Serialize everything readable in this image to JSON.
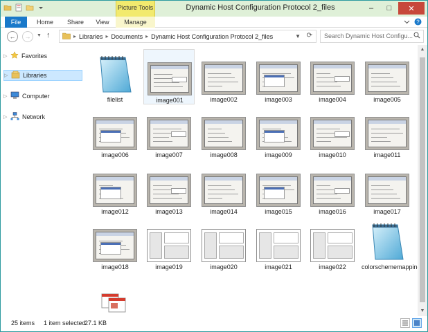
{
  "window": {
    "title": "Dynamic Host Configuration Protocol 2_files",
    "context_tab_group": "Picture Tools",
    "controls": {
      "minimize": "–",
      "maximize": "□",
      "close": "✕"
    }
  },
  "ribbon": {
    "tabs": [
      {
        "label": "File"
      },
      {
        "label": "Home"
      },
      {
        "label": "Share"
      },
      {
        "label": "View"
      },
      {
        "label": "Manage"
      }
    ]
  },
  "navigation": {
    "back": "←",
    "forward": "→",
    "up": "↑",
    "breadcrumb": [
      "Libraries",
      "Documents",
      "Dynamic Host Configuration Protocol 2_files"
    ],
    "search_placeholder": "Search Dynamic Host Configu..."
  },
  "navpane": {
    "items": [
      {
        "label": "Favorites",
        "icon": "star-icon"
      },
      {
        "label": "Libraries",
        "icon": "libraries-icon",
        "selected": true
      },
      {
        "label": "Computer",
        "icon": "computer-icon"
      },
      {
        "label": "Network",
        "icon": "network-icon"
      }
    ]
  },
  "files": [
    {
      "name": "filelist",
      "type": "notepad"
    },
    {
      "name": "image001",
      "type": "dialog",
      "selected": true
    },
    {
      "name": "image002",
      "type": "dialog"
    },
    {
      "name": "image003",
      "type": "dialog"
    },
    {
      "name": "image004",
      "type": "dialog"
    },
    {
      "name": "image005",
      "type": "dialog"
    },
    {
      "name": "image006",
      "type": "dialog"
    },
    {
      "name": "image007",
      "type": "dialog"
    },
    {
      "name": "image008",
      "type": "dialog"
    },
    {
      "name": "image009",
      "type": "dialog"
    },
    {
      "name": "image010",
      "type": "dialog"
    },
    {
      "name": "image011",
      "type": "dialog"
    },
    {
      "name": "image012",
      "type": "dialog"
    },
    {
      "name": "image013",
      "type": "dialog"
    },
    {
      "name": "image014",
      "type": "dialog"
    },
    {
      "name": "image015",
      "type": "dialog"
    },
    {
      "name": "image016",
      "type": "dialog"
    },
    {
      "name": "image017",
      "type": "dialog"
    },
    {
      "name": "image018",
      "type": "dialog"
    },
    {
      "name": "image019",
      "type": "screen"
    },
    {
      "name": "image020",
      "type": "screen"
    },
    {
      "name": "image021",
      "type": "screen"
    },
    {
      "name": "image022",
      "type": "screen"
    },
    {
      "name": "colorschememapping",
      "type": "notepad"
    },
    {
      "name": "",
      "type": "xml"
    }
  ],
  "status": {
    "item_count": "25 items",
    "selection": "1 item selected",
    "size": "27.1 KB"
  },
  "colors": {
    "accent": "#1979ca",
    "selection": "#cce8ff",
    "close": "#c7483a",
    "context_tab": "#f2ea6e"
  }
}
